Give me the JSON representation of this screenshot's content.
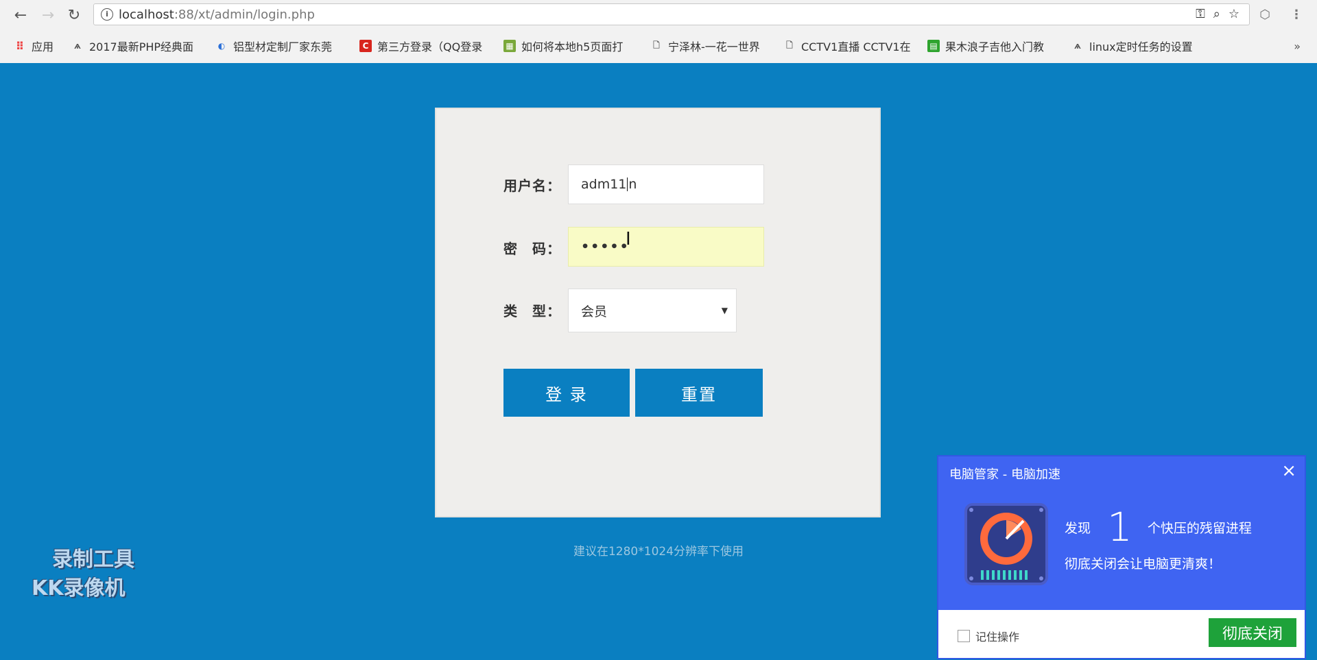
{
  "browser": {
    "url_host": "localhost",
    "url_path": ":88/xt/admin/login.php",
    "bookmarks": [
      {
        "label": "应用",
        "icon": "apps-grid-icon"
      },
      {
        "label": "2017最新PHP经典面",
        "icon": "paw-icon"
      },
      {
        "label": "铝型材定制厂家东莞",
        "icon": "shield-icon"
      },
      {
        "label": "第三方登录（QQ登录",
        "icon": "c-logo-icon"
      },
      {
        "label": "如何将本地h5页面打",
        "icon": "bookmark-site-icon"
      },
      {
        "label": "宁泽林-一花一世界",
        "icon": "page-icon"
      },
      {
        "label": "CCTV1直播 CCTV1在",
        "icon": "page-icon"
      },
      {
        "label": "果木浪子吉他入门教",
        "icon": "bookmark-site-icon"
      },
      {
        "label": "linux定时任务的设置",
        "icon": "paw-icon"
      }
    ],
    "more": "»"
  },
  "login": {
    "username_label": "用户名：",
    "username_value": "adm11",
    "username_value_after": "n",
    "password_label": "密　码：",
    "password_value": "•••••",
    "type_label": "类　型：",
    "type_value": "会员",
    "login_button": "登 录",
    "reset_button": "重置"
  },
  "hint": "建议在1280*1024分辨率下使用",
  "watermark": {
    "line1": "录制工具",
    "line2": "KK录像机"
  },
  "popup": {
    "title": "电脑管家 - 电脑加速",
    "found_prefix": "发现",
    "found_count": "1",
    "found_suffix": "个快压的残留进程",
    "message": "彻底关闭会让电脑更清爽！",
    "remember_label": "记住操作",
    "close_all_button": "彻底关闭"
  },
  "colors": {
    "page_bg": "#0a7fc1",
    "button": "#0a7fc1",
    "popup_bg": "#3f64f2",
    "popup_button": "#1ea23a"
  }
}
